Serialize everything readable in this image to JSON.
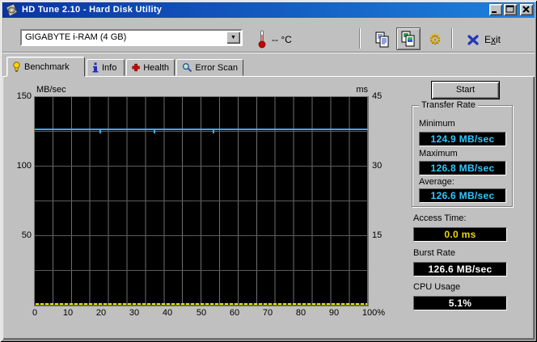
{
  "window": {
    "title": "HD Tune 2.10 - Hard Disk Utility"
  },
  "toolbar": {
    "drive_select": {
      "value": "GIGABYTE i-RAM (4 GB)"
    },
    "temperature": "-- °C",
    "exit": {
      "pre": "E",
      "key": "x",
      "post": "it"
    }
  },
  "tabs": {
    "items": [
      {
        "label": "Benchmark",
        "active": true
      },
      {
        "label": "Info",
        "active": false
      },
      {
        "label": "Health",
        "active": false
      },
      {
        "label": "Error Scan",
        "active": false
      }
    ]
  },
  "benchmark": {
    "start_label": "Start",
    "transfer_rate": {
      "group_label": "Transfer Rate",
      "minimum_label": "Minimum",
      "minimum_value": "124.9 MB/sec",
      "maximum_label": "Maximum",
      "maximum_value": "126.8 MB/sec",
      "average_label": "Average:",
      "average_value": "126.6 MB/sec"
    },
    "access_time_label": "Access Time:",
    "access_time_value": "0.0 ms",
    "burst_rate_label": "Burst Rate",
    "burst_rate_value": "126.6 MB/sec",
    "cpu_usage_label": "CPU Usage",
    "cpu_usage_value": "5.1%"
  },
  "chart_data": {
    "type": "line",
    "left_axis": {
      "label": "MB/sec",
      "ticks": [
        "150",
        "100",
        "50"
      ],
      "range": [
        0,
        150
      ]
    },
    "right_axis": {
      "label": "ms",
      "ticks": [
        "45",
        "30",
        "15"
      ],
      "range": [
        0,
        45
      ]
    },
    "x_axis": {
      "ticks": [
        "0",
        "10",
        "20",
        "30",
        "40",
        "50",
        "60",
        "70",
        "80",
        "90",
        "100%"
      ],
      "range_percent": [
        0,
        100
      ]
    },
    "grid": {
      "vertical_divisions": 18,
      "horizontal_step_mb_sec": 25,
      "background": "#000000",
      "grid_color": "#6a6a6a"
    },
    "series": [
      {
        "name": "transfer-rate",
        "color": "#3fa9f5",
        "unit": "MB/sec",
        "description": "nearly flat line at ~126.6 MB/sec across 0-100%",
        "min": 124.9,
        "max": 126.8,
        "average": 126.6,
        "dips_at_percent": [
          19,
          36,
          53
        ]
      },
      {
        "name": "access-time",
        "color": "#e8e800",
        "unit": "ms",
        "description": "dotted line at 0 ms along chart bottom",
        "value": 0.0
      }
    ],
    "legend": "none"
  },
  "icons": {
    "app": "hd-disk",
    "temperature": "thermometer",
    "copy": "copy-pages",
    "copy_image": "copy-image",
    "options": "gear",
    "exit": "blue-x",
    "benchmark_tab": "yellow-bulb",
    "info_tab": "blue-i",
    "health_tab": "red-cross",
    "error_scan_tab": "magnifier",
    "combo_arrow": "▼",
    "gear_glyph": "⚙"
  },
  "colors": {
    "titlebar_left": "#0a34a4",
    "titlebar_right": "#1e82dc",
    "chrome": "#c0c0c0",
    "plot_bg": "#000000",
    "grid": "#6a6a6a",
    "transfer_line": "#3fa9f5",
    "access_line": "#e8e800",
    "transfer_value_text": "#2fc8ff",
    "access_value_text": "#e8d800",
    "white_value_text": "#ffffff",
    "value_box_bg": "#000000"
  }
}
